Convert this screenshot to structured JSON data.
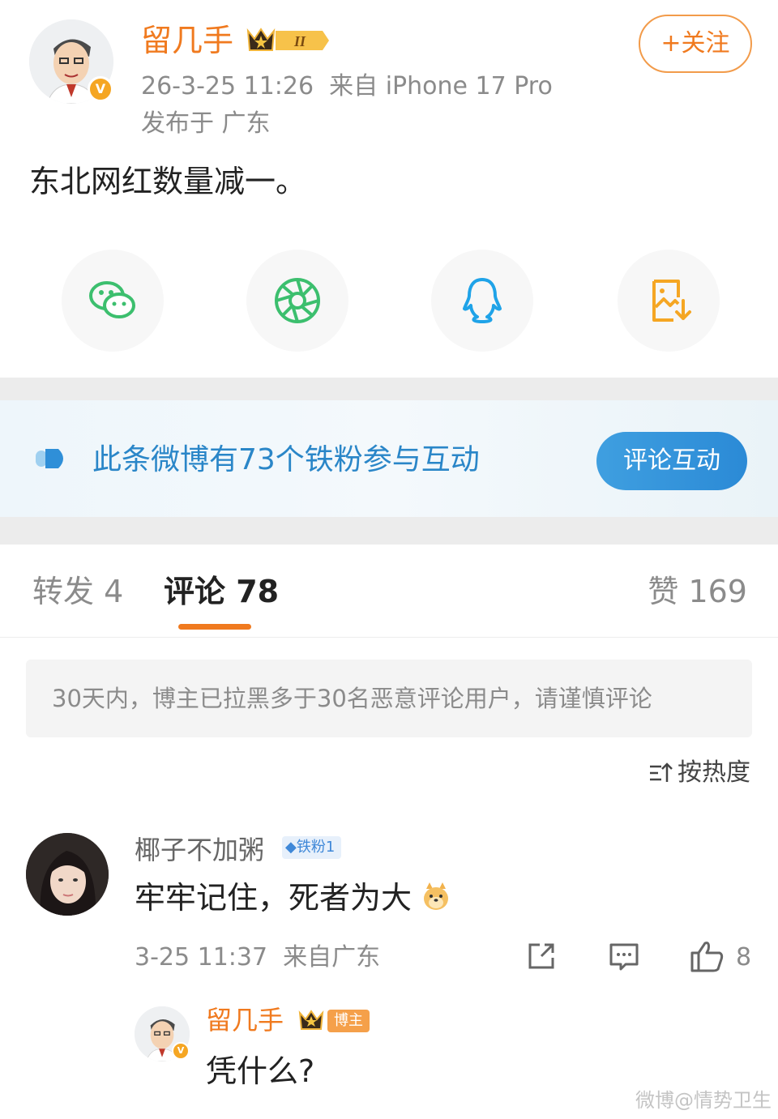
{
  "post": {
    "author": "留几手",
    "level_badge": "II",
    "verified_mark": "V",
    "timestamp": "26-3-25 11:26",
    "source": "来自 iPhone 17 Pro",
    "location": "发布于 广东",
    "follow_label": "+关注",
    "text": "东北网红数量减一。"
  },
  "share": {
    "icons": [
      "wechat-icon",
      "moments-icon",
      "qq-icon",
      "save-image-icon"
    ]
  },
  "banner": {
    "text": "此条微博有73个铁粉参与互动",
    "button_label": "评论互动"
  },
  "tabs": {
    "repost": "转发 4",
    "comment": "评论 78",
    "like": "赞 169"
  },
  "notice": "30天内，博主已拉黑多于30名恶意评论用户，请谨慎评论",
  "sort_label": "按热度",
  "comment": {
    "user": "椰子不加粥",
    "fan_badge": "铁粉1",
    "text": "牢牢记住，死者为大",
    "time": "3-25 11:37",
    "source": "来自广东",
    "like_count": "8"
  },
  "reply": {
    "user": "留几手",
    "tag": "博主",
    "text": "凭什么?"
  },
  "watermark": "微博@情势卫生"
}
